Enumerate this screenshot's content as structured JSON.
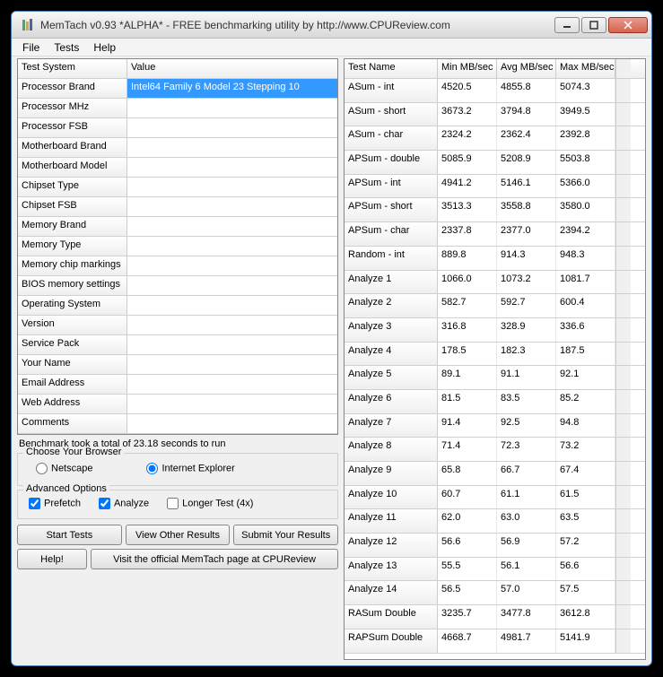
{
  "window": {
    "title": "MemTach v0.93 *ALPHA* - FREE benchmarking utility by http://www.CPUReview.com"
  },
  "menu": {
    "file": "File",
    "tests": "Tests",
    "help": "Help"
  },
  "leftGrid": {
    "headers": {
      "c1": "Test System",
      "c2": "Value"
    },
    "rows": [
      {
        "label": "Processor Brand",
        "value": "Intel64 Family 6 Model 23 Stepping 10",
        "selected": true
      },
      {
        "label": "Processor MHz",
        "value": ""
      },
      {
        "label": "Processor FSB",
        "value": ""
      },
      {
        "label": "Motherboard Brand",
        "value": ""
      },
      {
        "label": "Motherboard Model",
        "value": ""
      },
      {
        "label": "Chipset Type",
        "value": ""
      },
      {
        "label": "Chipset FSB",
        "value": ""
      },
      {
        "label": "Memory Brand",
        "value": ""
      },
      {
        "label": "Memory Type",
        "value": ""
      },
      {
        "label": "Memory chip markings",
        "value": ""
      },
      {
        "label": "BIOS memory settings",
        "value": ""
      },
      {
        "label": "Operating System",
        "value": ""
      },
      {
        "label": "Version",
        "value": ""
      },
      {
        "label": "Service Pack",
        "value": ""
      },
      {
        "label": "Your Name",
        "value": ""
      },
      {
        "label": "Email Address",
        "value": ""
      },
      {
        "label": "Web Address",
        "value": ""
      },
      {
        "label": "Comments",
        "value": ""
      }
    ]
  },
  "status": "Benchmark took a total of 23.18 seconds to run",
  "browserGroup": {
    "title": "Choose Your Browser",
    "netscape": "Netscape",
    "ie": "Internet Explorer"
  },
  "advancedGroup": {
    "title": "Advanced Options",
    "prefetch": "Prefetch",
    "analyze": "Analyze",
    "longer": "Longer Test (4x)"
  },
  "buttons": {
    "start": "Start Tests",
    "view": "View Other Results",
    "submit": "Submit Your Results",
    "help": "Help!",
    "visit": "Visit the official MemTach page at CPUReview"
  },
  "rightGrid": {
    "headers": {
      "c1": "Test Name",
      "c2": "Min MB/sec",
      "c3": "Avg MB/sec",
      "c4": "Max MB/sec"
    },
    "rows": [
      {
        "name": "ASum - int",
        "min": "4520.5",
        "avg": "4855.8",
        "max": "5074.3"
      },
      {
        "name": "ASum - short",
        "min": "3673.2",
        "avg": "3794.8",
        "max": "3949.5"
      },
      {
        "name": "ASum - char",
        "min": "2324.2",
        "avg": "2362.4",
        "max": "2392.8"
      },
      {
        "name": "APSum - double",
        "min": "5085.9",
        "avg": "5208.9",
        "max": "5503.8"
      },
      {
        "name": "APSum - int",
        "min": "4941.2",
        "avg": "5146.1",
        "max": "5366.0"
      },
      {
        "name": "APSum - short",
        "min": "3513.3",
        "avg": "3558.8",
        "max": "3580.0"
      },
      {
        "name": "APSum - char",
        "min": "2337.8",
        "avg": "2377.0",
        "max": "2394.2"
      },
      {
        "name": "Random - int",
        "min": "889.8",
        "avg": "914.3",
        "max": "948.3"
      },
      {
        "name": "Analyze 1",
        "min": "1066.0",
        "avg": "1073.2",
        "max": "1081.7"
      },
      {
        "name": "Analyze 2",
        "min": "582.7",
        "avg": "592.7",
        "max": "600.4"
      },
      {
        "name": "Analyze 3",
        "min": "316.8",
        "avg": "328.9",
        "max": "336.6"
      },
      {
        "name": "Analyze 4",
        "min": "178.5",
        "avg": "182.3",
        "max": "187.5"
      },
      {
        "name": "Analyze 5",
        "min": "89.1",
        "avg": "91.1",
        "max": "92.1"
      },
      {
        "name": "Analyze 6",
        "min": "81.5",
        "avg": "83.5",
        "max": "85.2"
      },
      {
        "name": "Analyze 7",
        "min": "91.4",
        "avg": "92.5",
        "max": "94.8"
      },
      {
        "name": "Analyze 8",
        "min": "71.4",
        "avg": "72.3",
        "max": "73.2"
      },
      {
        "name": "Analyze 9",
        "min": "65.8",
        "avg": "66.7",
        "max": "67.4"
      },
      {
        "name": "Analyze 10",
        "min": "60.7",
        "avg": "61.1",
        "max": "61.5"
      },
      {
        "name": "Analyze 11",
        "min": "62.0",
        "avg": "63.0",
        "max": "63.5"
      },
      {
        "name": "Analyze 12",
        "min": "56.6",
        "avg": "56.9",
        "max": "57.2"
      },
      {
        "name": "Analyze 13",
        "min": "55.5",
        "avg": "56.1",
        "max": "56.6"
      },
      {
        "name": "Analyze 14",
        "min": "56.5",
        "avg": "57.0",
        "max": "57.5"
      },
      {
        "name": "RASum Double",
        "min": "3235.7",
        "avg": "3477.8",
        "max": "3612.8"
      },
      {
        "name": "RAPSum Double",
        "min": "4668.7",
        "avg": "4981.7",
        "max": "5141.9"
      }
    ]
  }
}
